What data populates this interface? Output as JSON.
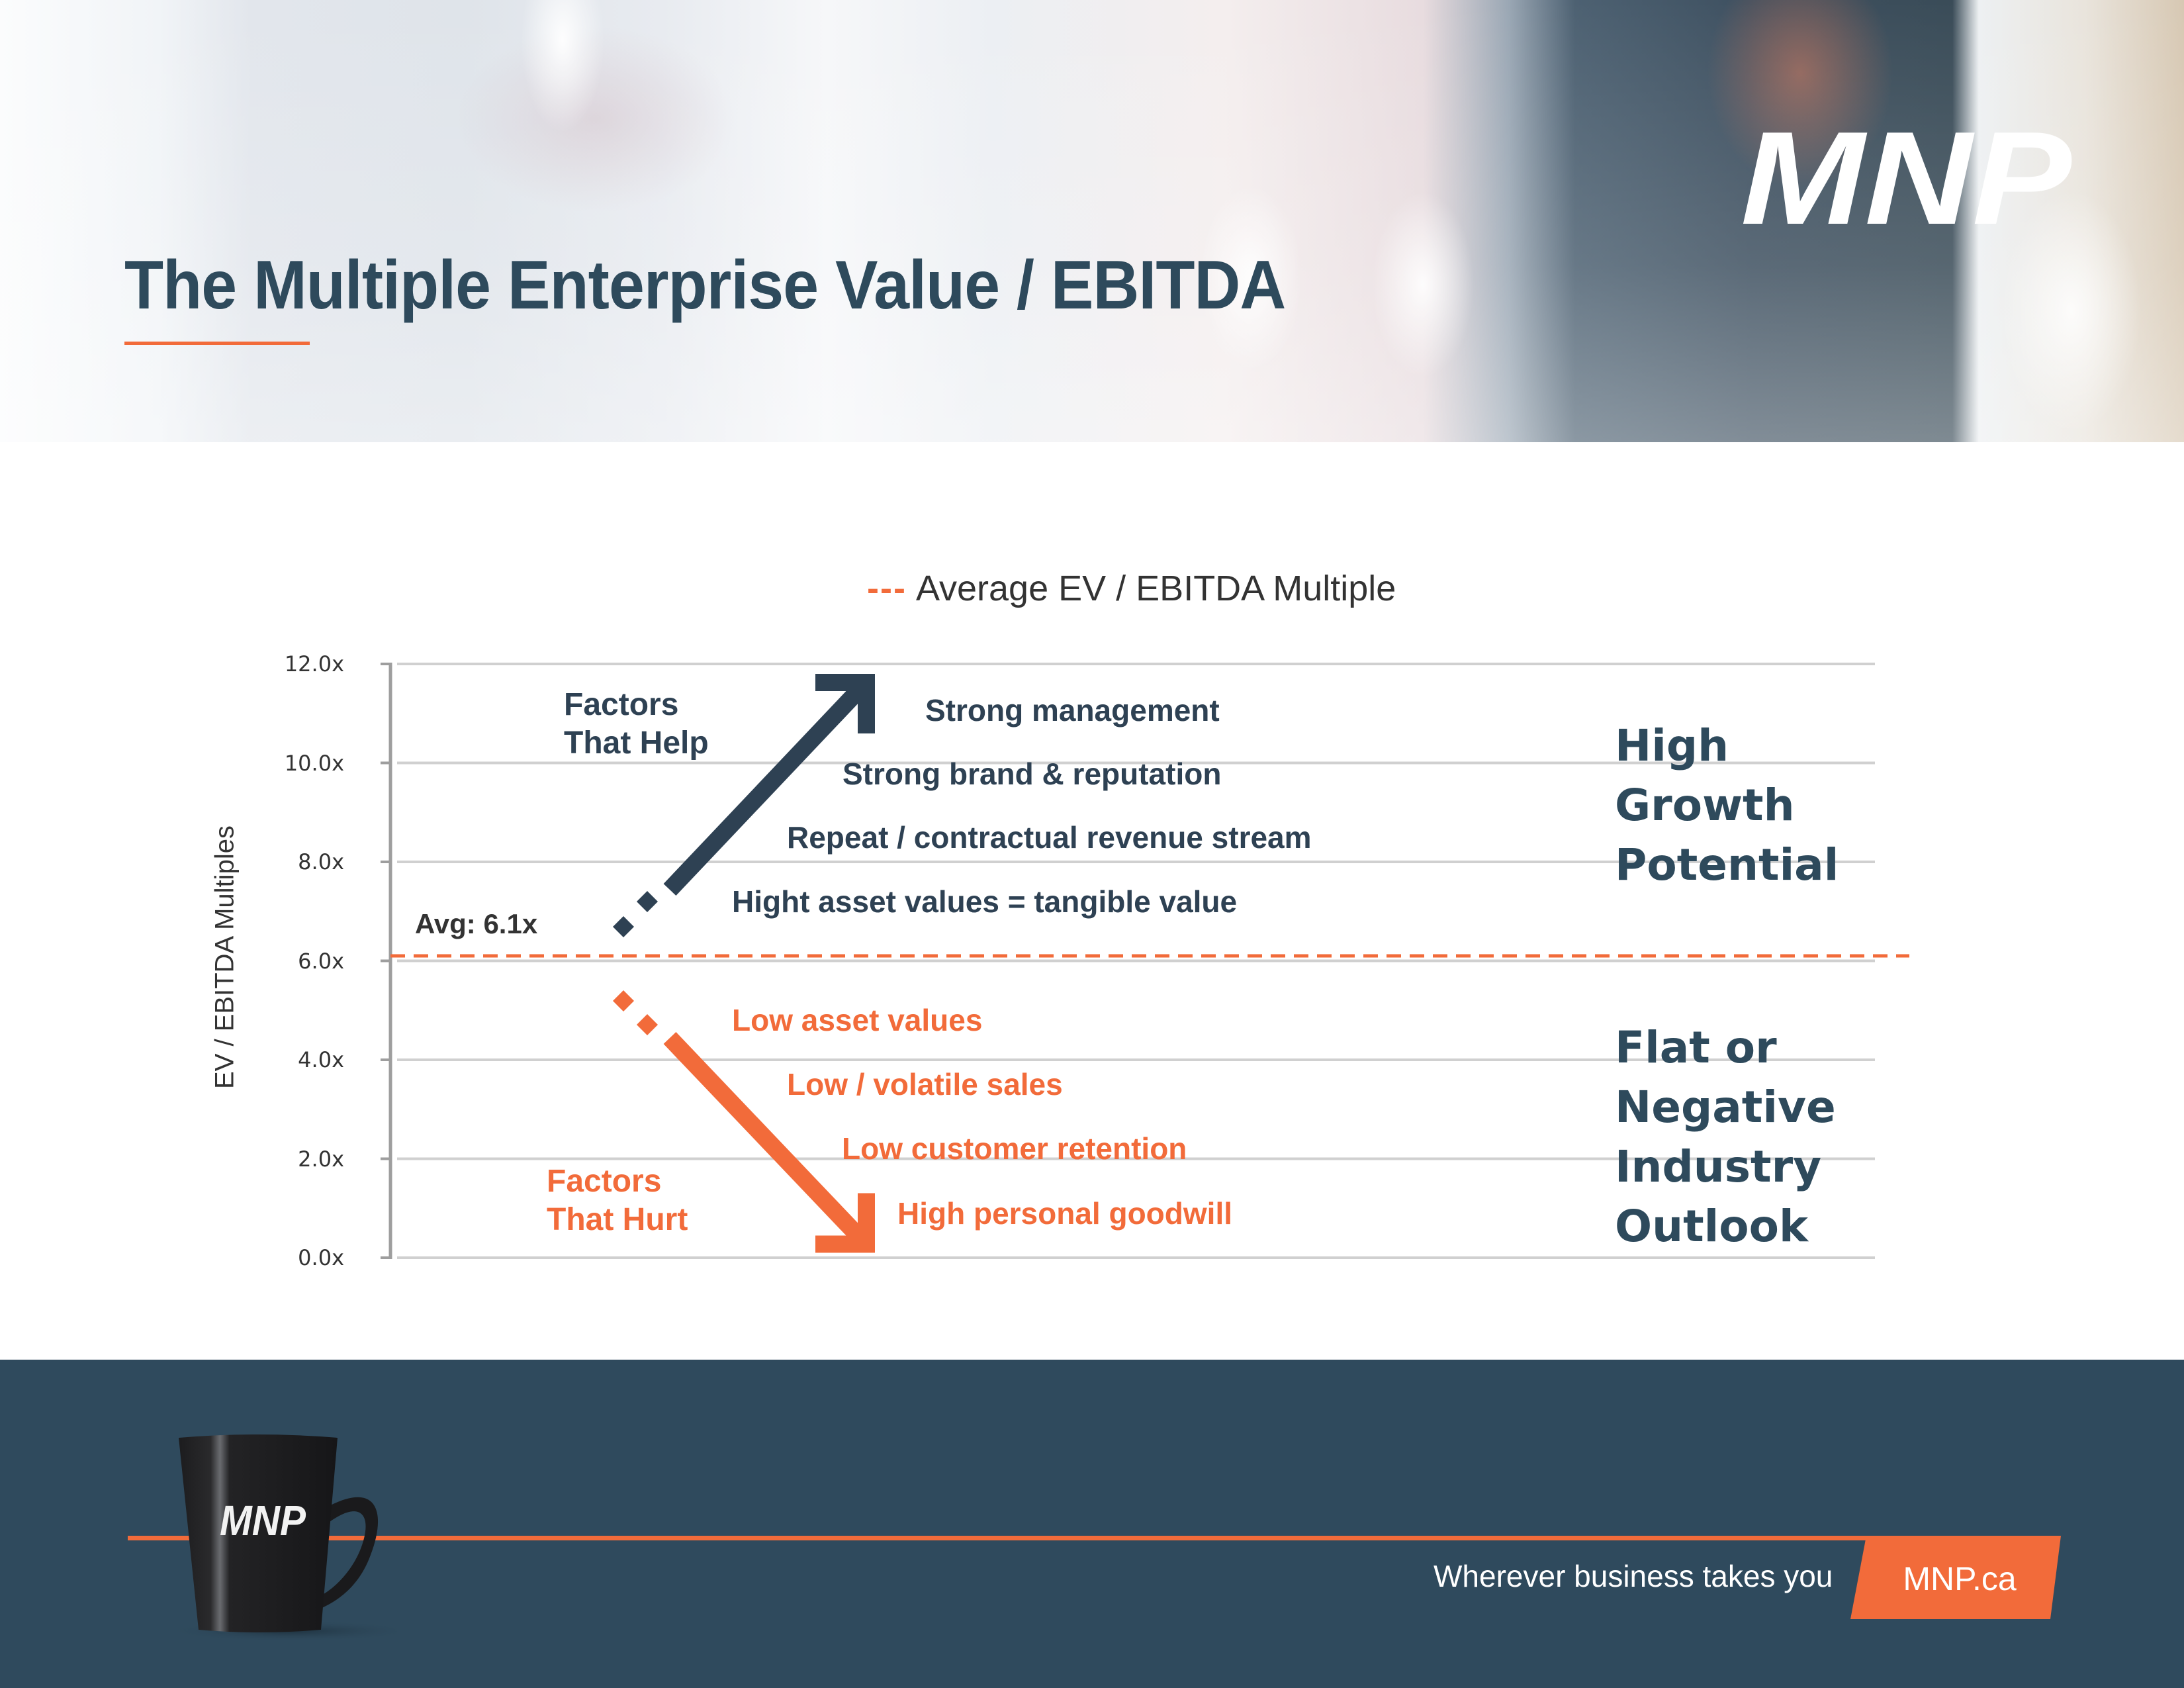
{
  "header": {
    "title": "The Multiple Enterprise Value / EBITDA",
    "logo_text": "MNP"
  },
  "chart_data": {
    "type": "line",
    "title": "",
    "legend": {
      "entries": [
        {
          "label": "Average EV / EBITDA Multiple",
          "style": "dashed",
          "color": "#f26b3a"
        }
      ],
      "swatch_text": "---",
      "placement": "top-center"
    },
    "ylabel": "EV / EBITDA Multiples",
    "xlabel": "",
    "ylim": [
      0,
      12
    ],
    "y_ticks": [
      0,
      2,
      4,
      6,
      8,
      10,
      12
    ],
    "y_tick_labels": [
      "0.0x",
      "2.0x",
      "4.0x",
      "6.0x",
      "8.0x",
      "10.0x",
      "12.0x"
    ],
    "grid": true,
    "reference_lines": [
      {
        "name": "average",
        "value": 6.1,
        "label": "Avg: 6.1x",
        "color": "#f26b3a",
        "style": "dashed"
      }
    ],
    "arrows": [
      {
        "name": "factors-that-help",
        "direction": "up",
        "from_value": 6.1,
        "to_value": 11.8,
        "color": "#2e4153"
      },
      {
        "name": "factors-that-hurt",
        "direction": "down",
        "from_value": 6.1,
        "to_value": 0.1,
        "color": "#f26b3a"
      }
    ],
    "groups": [
      {
        "name": "Factors That Help",
        "heading": [
          "Factors",
          "That Help"
        ],
        "color": "#2e4153",
        "items": [
          "Strong management",
          "Strong brand & reputation",
          "Repeat / contractual revenue stream",
          "Hight asset values = tangible value"
        ],
        "outcome": [
          "High",
          "Growth",
          "Potential"
        ]
      },
      {
        "name": "Factors That Hurt",
        "heading": [
          "Factors",
          "That Hurt"
        ],
        "color": "#f26b3a",
        "items": [
          "Low asset values",
          "Low / volatile sales",
          "Low customer retention",
          "High personal goodwill"
        ],
        "outcome": [
          "Flat or",
          "Negative",
          "Industry",
          "Outlook"
        ]
      }
    ]
  },
  "footer": {
    "mug_logo_text": "MNP",
    "tagline": "Wherever business takes you",
    "site_label": "MNP.ca"
  },
  "colors": {
    "brand_navy": "#2f4a5d",
    "brand_orange": "#f26b3a",
    "text_dark": "#333333"
  }
}
